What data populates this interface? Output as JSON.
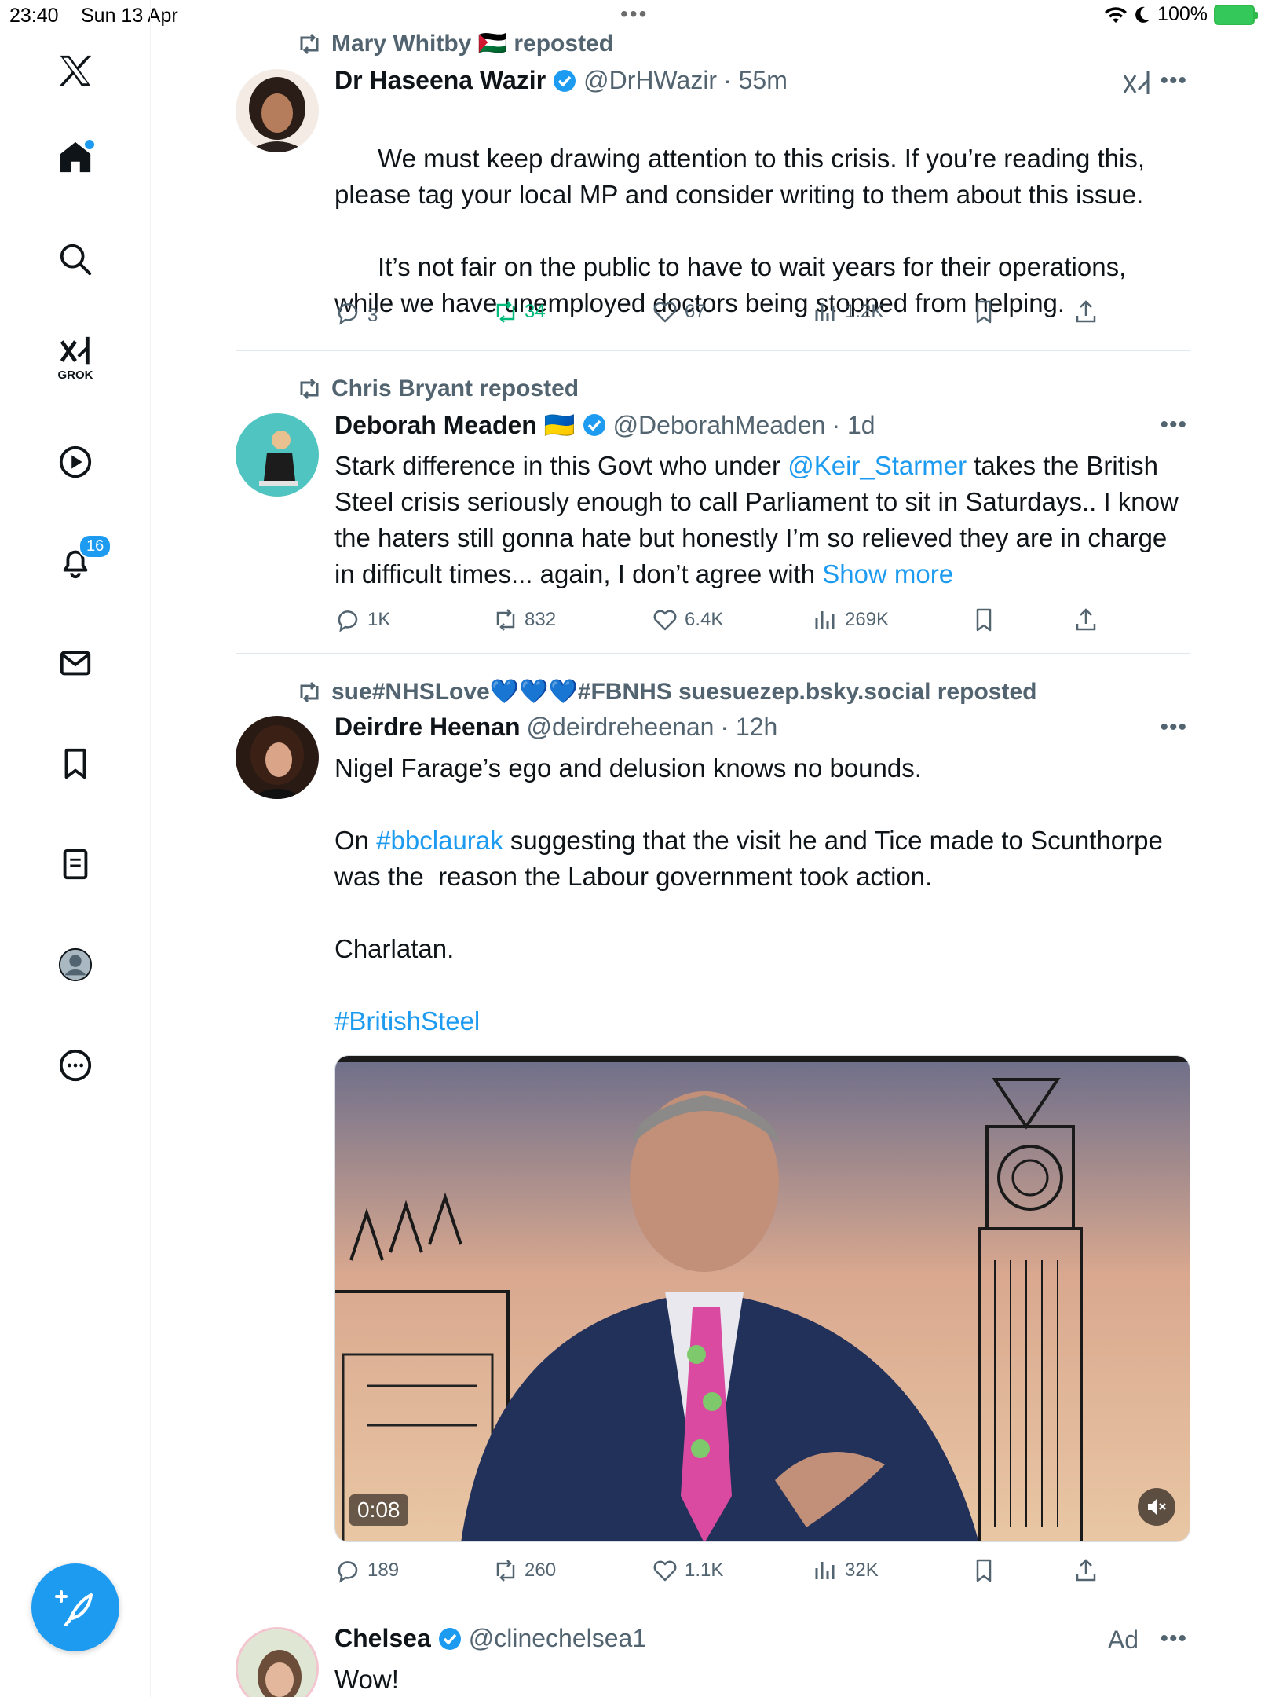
{
  "status_bar": {
    "time": "23:40",
    "date": "Sun 13 Apr",
    "battery": "100%"
  },
  "sidebar": {
    "grok_label": "GROK",
    "notifications_badge": "16"
  },
  "tweets": [
    {
      "repost_by": "Mary Whitby 🇵🇸 reposted",
      "name": "Dr Haseena Wazir",
      "handle": "@DrHWazir",
      "time": "· 55m",
      "body1": "We must keep drawing attention to this crisis. If you’re reading this, please tag your local MP and consider writing to them about this issue.",
      "body2": "It’s not fair on the public to have to wait years for their operations, while we have unemployed doctors being stopped from helping.",
      "replies": "3",
      "reposts": "34",
      "likes": "67",
      "views": "1.2K"
    },
    {
      "repost_by": "Chris Bryant reposted",
      "name": "Deborah Meaden 🇺🇦",
      "handle": "@DeborahMeaden",
      "time": "· 1d",
      "body_pre": "Stark difference in this Govt who under ",
      "mention": "@Keir_Starmer",
      "body_post": " takes the British Steel crisis seriously enough to call Parliament to sit in Saturdays.. I know the haters still gonna hate but honestly I’m so relieved they are in charge in difficult times... again, I don’t agree with ",
      "show_more": "Show more",
      "replies": "1K",
      "reposts": "832",
      "likes": "6.4K",
      "views": "269K"
    },
    {
      "repost_by": "sue#NHSLove💙💙💙#FBNHS suesuezep.bsky.social reposted",
      "name": "Deirdre Heenan",
      "handle": "@deirdreheenan",
      "time": "· 12h",
      "line1": "Nigel Farage’s ego and delusion knows no bounds.",
      "line2_pre": "On ",
      "hashtag1": "#bbclaurak",
      "line2_post": " suggesting that the visit he and Tice made to Scunthorpe was the  reason the Labour government took action.",
      "line3": "Charlatan.",
      "hashtag2": "#BritishSteel",
      "video_duration": "0:08",
      "replies": "189",
      "reposts": "260",
      "likes": "1.1K",
      "views": "32K"
    },
    {
      "name": "Chelsea",
      "handle": "@clinechelsea1",
      "ad": "Ad",
      "body": "Wow!"
    }
  ],
  "colors": {
    "accent": "#1d9bf0",
    "repost_green": "#00ba7c",
    "muted": "#536471"
  }
}
